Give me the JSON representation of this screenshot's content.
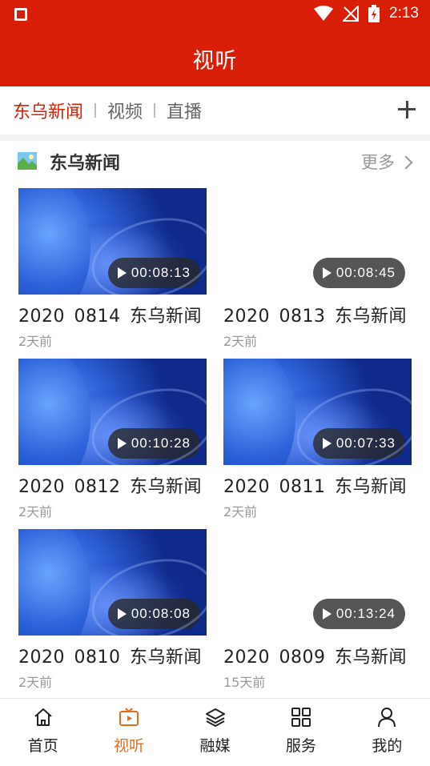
{
  "status_bar": {
    "time": "2:13"
  },
  "header": {
    "title": "视听"
  },
  "tabs": [
    {
      "label": "东乌新闻",
      "active": true
    },
    {
      "label": "视频",
      "active": false
    },
    {
      "label": "直播",
      "active": false
    }
  ],
  "section": {
    "title": "东乌新闻",
    "more_label": "更多"
  },
  "videos": [
    {
      "title": "2020  0814  东乌新闻",
      "time_ago": "2天前",
      "duration": "00:08:13",
      "has_thumbnail": true
    },
    {
      "title": "2020  0813  东乌新闻",
      "time_ago": "2天前",
      "duration": "00:08:45",
      "has_thumbnail": false
    },
    {
      "title": "2020  0812  东乌新闻",
      "time_ago": "2天前",
      "duration": "00:10:28",
      "has_thumbnail": true
    },
    {
      "title": "2020  0811  东乌新闻",
      "time_ago": "2天前",
      "duration": "00:07:33",
      "has_thumbnail": true
    },
    {
      "title": "2020  0810  东乌新闻",
      "time_ago": "2天前",
      "duration": "00:08:08",
      "has_thumbnail": true
    },
    {
      "title": "2020  0809  东乌新闻",
      "time_ago": "15天前",
      "duration": "00:13:24",
      "has_thumbnail": false
    }
  ],
  "bottom_nav": [
    {
      "label": "首页",
      "icon": "home-icon",
      "active": false
    },
    {
      "label": "视听",
      "icon": "tv-icon",
      "active": true
    },
    {
      "label": "融媒",
      "icon": "layers-icon",
      "active": false
    },
    {
      "label": "服务",
      "icon": "grid-icon",
      "active": false
    },
    {
      "label": "我的",
      "icon": "user-icon",
      "active": false
    }
  ],
  "colors": {
    "brand_red": "#d81e06",
    "nav_active": "#e86a1b"
  }
}
